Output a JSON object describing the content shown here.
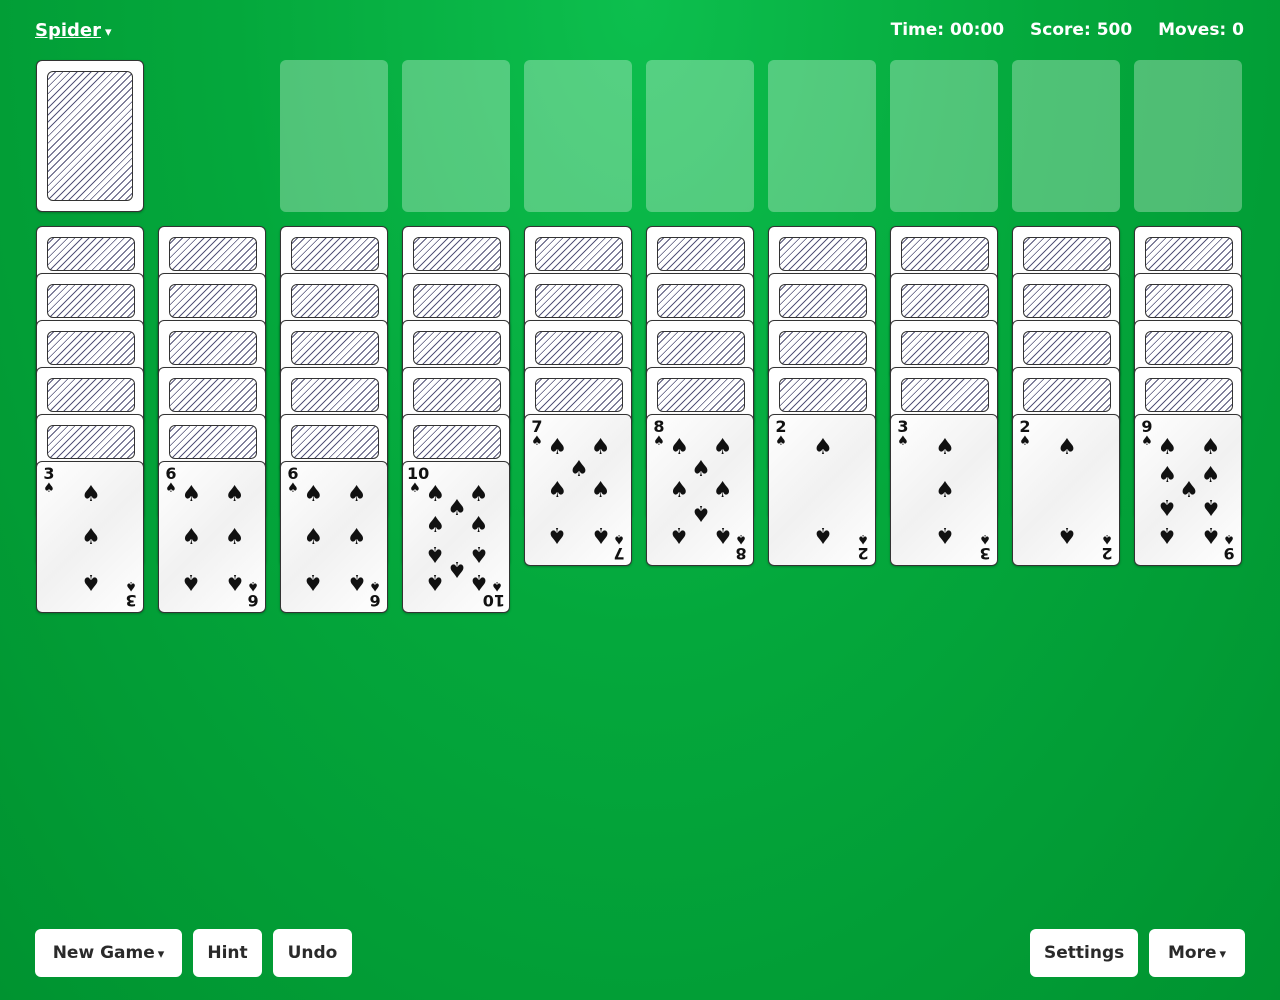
{
  "header": {
    "game_title": "Spider",
    "title_caret": "▾",
    "time_label": "Time:",
    "time_value": "00:00",
    "score_label": "Score:",
    "score_value": "500",
    "moves_label": "Moves:",
    "moves_value": "0"
  },
  "foundations_count": 8,
  "stock": {
    "face_down": true
  },
  "suit_symbol": "♠",
  "suit_icon": "spade-icon",
  "colors": {
    "felt": "#04a83c",
    "card_back_stripe": "#55557a",
    "text_on_felt": "#ffffff"
  },
  "tableau": [
    {
      "face_down": 5,
      "face_up": [
        "3"
      ]
    },
    {
      "face_down": 5,
      "face_up": [
        "6"
      ]
    },
    {
      "face_down": 5,
      "face_up": [
        "6"
      ]
    },
    {
      "face_down": 5,
      "face_up": [
        "10"
      ]
    },
    {
      "face_down": 4,
      "face_up": [
        "7"
      ]
    },
    {
      "face_down": 4,
      "face_up": [
        "8"
      ]
    },
    {
      "face_down": 4,
      "face_up": [
        "2"
      ]
    },
    {
      "face_down": 4,
      "face_up": [
        "3"
      ]
    },
    {
      "face_down": 4,
      "face_up": [
        "2"
      ]
    },
    {
      "face_down": 4,
      "face_up": [
        "9"
      ]
    }
  ],
  "footer": {
    "new_game_label": "New Game",
    "hint_label": "Hint",
    "undo_label": "Undo",
    "settings_label": "Settings",
    "more_label": "More",
    "caret": "▾"
  }
}
